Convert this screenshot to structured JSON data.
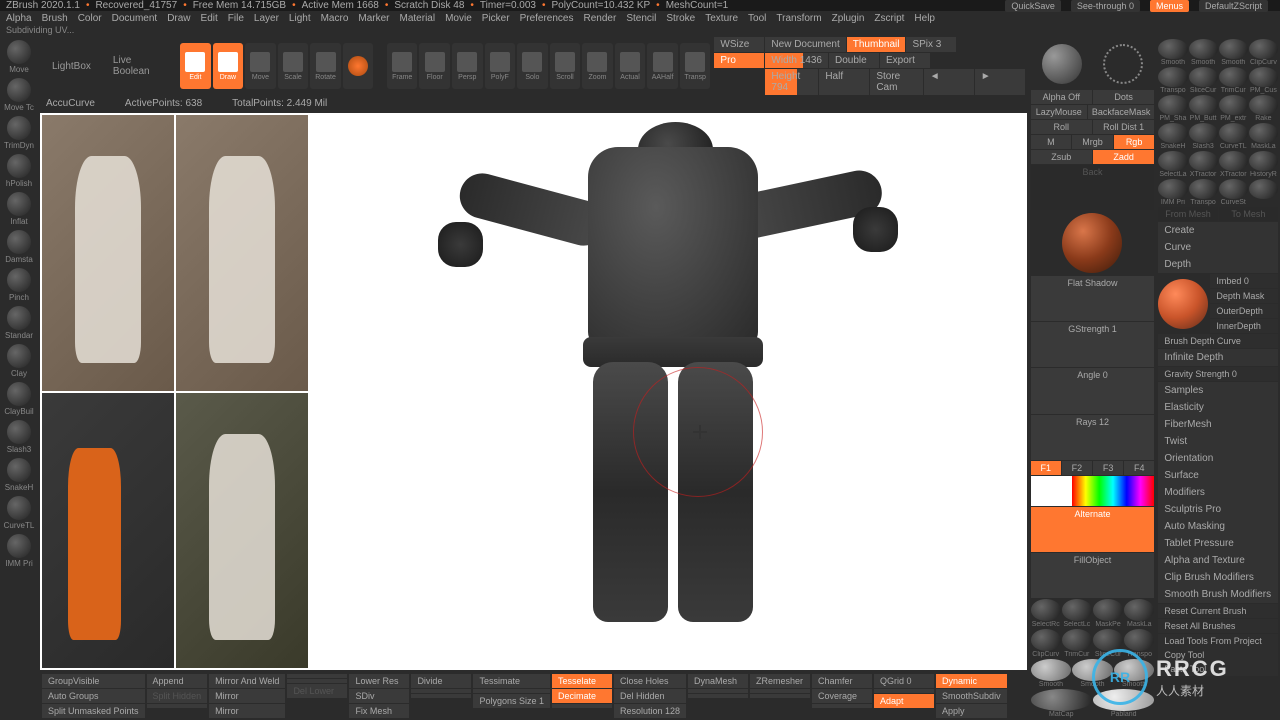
{
  "title": {
    "app": "ZBrush 2020.1.1",
    "doc": "Recovered_41757",
    "mem": "Free Mem 14.715GB",
    "activemem": "Active Mem 1668",
    "scratch": "Scratch Disk 48",
    "timer": "Timer=0.003",
    "poly": "PolyCount=10.432 KP",
    "mesh": "MeshCount=1"
  },
  "topright": {
    "quicksave": "QuickSave",
    "seethrough": "See-through 0",
    "menus": "Menus",
    "script": "DefaultZScript"
  },
  "menubar": [
    "Alpha",
    "Brush",
    "Color",
    "Document",
    "Draw",
    "Edit",
    "File",
    "Layer",
    "Light",
    "Macro",
    "Marker",
    "Material",
    "Movie",
    "Picker",
    "Preferences",
    "Render",
    "Stencil",
    "Stroke",
    "Texture",
    "Tool",
    "Transform",
    "Zplugin",
    "Zscript",
    "Help"
  ],
  "statusline": "Subdividing UV...",
  "leftbrushes": [
    "Move",
    "Move Tc",
    "TrimDyn",
    "hPolish",
    "Inflat",
    "Damsta",
    "Pinch",
    "Standar",
    "Clay",
    "ClayBuil",
    "Slash3",
    "SnakeH",
    "CurveTL",
    "IMM Pri"
  ],
  "toolbar": {
    "lightbox": "LightBox",
    "livebool": "Live Boolean",
    "edit": "Edit",
    "draw": "Draw",
    "move": "Move",
    "scale": "Scale",
    "rotate": "Rotate",
    "gimbal": "",
    "frame": "Frame",
    "floor": "Floor",
    "persp": "Persp",
    "polyf": "PolyF",
    "local": "",
    "solo": "Solo",
    "scroll": "Scroll",
    "zoom": "Zoom",
    "actual": "Actual",
    "aahalf": "AAHalf",
    "transp": "Transp"
  },
  "docpanel": {
    "wsize": "WSize",
    "newdoc": "New Document",
    "thumb": "Thumbnail",
    "pro": "Pro",
    "width": "Width 1436",
    "double": "Double",
    "height": "Height 794",
    "half": "Half",
    "export": "Export",
    "storecam": "Store Cam",
    "spix": "SPix 3"
  },
  "infobar": {
    "accu": "AccuCurve",
    "active": "ActivePoints: 638",
    "total": "TotalPoints: 2.449 Mil"
  },
  "bottombar": {
    "col1": [
      "GroupVisible",
      "Auto Groups",
      "Split Unmasked Points"
    ],
    "col2": [
      "Append",
      "Split Hidden",
      ""
    ],
    "col3": [
      "Mirror And Weld",
      "Mirror",
      "Mirror"
    ],
    "col4": [
      "",
      "",
      "Del Lower"
    ],
    "col5": [
      "Lower Res",
      "SDiv",
      "Fix Mesh"
    ],
    "col6": [
      "Divide",
      "",
      ""
    ],
    "col7": [
      "Tessimate",
      "",
      "Polygons Size 1"
    ],
    "col8": [
      "Tesselate",
      "Decimate",
      ""
    ],
    "col9": [
      "Close Holes",
      "Del Hidden",
      "Resolution 128"
    ],
    "col10": [
      "DynaMesh",
      "",
      ""
    ],
    "col11": [
      "ZRemesher",
      "",
      ""
    ],
    "col12": [
      "Chamfer",
      "Coverage",
      ""
    ],
    "col13": [
      "QGrid 0",
      "",
      "Adapt"
    ],
    "col14": [
      "Dynamic",
      "SmoothSubdiv",
      "Apply"
    ]
  },
  "rightpanel": {
    "dots": "Dots",
    "alphaoff": "Alpha Off",
    "lazy": "LazyMouse",
    "backface": "BackfaceMask",
    "roll": "Roll",
    "rolldist": "Roll Dist 1",
    "m": "M",
    "mrgb": "Mrgb",
    "rgb": "Rgb",
    "zsub": "Zsub",
    "zadd": "Zadd",
    "back": "Back",
    "flat": "Flat Shadow",
    "gstr": "GStrength 1",
    "angle": "Angle 0",
    "rays": "Rays 12",
    "f": [
      "F1",
      "F2",
      "F3",
      "F4"
    ],
    "alternate": "Alternate",
    "fillobj": "FillObject",
    "small_orbs": [
      "SelectRc",
      "SelectLc",
      "MaskPe",
      "MaskLa"
    ],
    "small_orbs2": [
      "ClipCurv",
      "TrimCur",
      "SliceCur",
      "Transpo"
    ],
    "smooth": [
      "Smooth",
      "Smooth",
      "Smooth"
    ],
    "mat": [
      "MatCap",
      "Pabland"
    ]
  },
  "farcol": {
    "topbrush_row1": [
      "Smooth",
      "Smooth",
      "Smooth",
      "ClipCurv"
    ],
    "topbrush_row2": [
      "Transpo",
      "SliceCur",
      "TrimCur",
      "PM_Cus"
    ],
    "topbrush_row3": [
      "PM_Sha",
      "PM_Butt",
      "PM_extr",
      "Rake"
    ],
    "topbrush_row4": [
      "SnakeH",
      "Slash3",
      "CurveTL",
      "MaskLa"
    ],
    "topbrush_row5": [
      "SelectLa",
      "XTractor",
      "XTractor",
      "HistoryR"
    ],
    "topbrush_row6": [
      "IMM Pri",
      "Transpo",
      "CurveSt",
      ""
    ],
    "frommesh": "From Mesh",
    "tomesh": "To Mesh",
    "sections1": [
      "Create",
      "Curve",
      "Depth"
    ],
    "depth": {
      "imbed": "Imbed 0",
      "depthmask": "Depth Mask",
      "outer": "OuterDepth",
      "inner": "InnerDepth",
      "bdc": "Brush Depth Curve",
      "infinite": "Infinite Depth",
      "gravity": "Gravity Strength 0"
    },
    "sections2": [
      "Samples",
      "Elasticity",
      "FiberMesh",
      "Twist",
      "Orientation",
      "Surface",
      "Modifiers",
      "Sculptris Pro",
      "Auto Masking",
      "Tablet Pressure",
      "Alpha and Texture",
      "Clip Brush Modifiers",
      "Smooth Brush Modifiers"
    ],
    "reset1": "Reset Current Brush",
    "reset2": "Reset All Brushes",
    "tools": [
      "Load Tools From Project",
      "Copy Tool",
      "Paste Tool"
    ]
  },
  "logo": {
    "ring": "RR",
    "big": "RRCG",
    "small": "人人素材"
  }
}
